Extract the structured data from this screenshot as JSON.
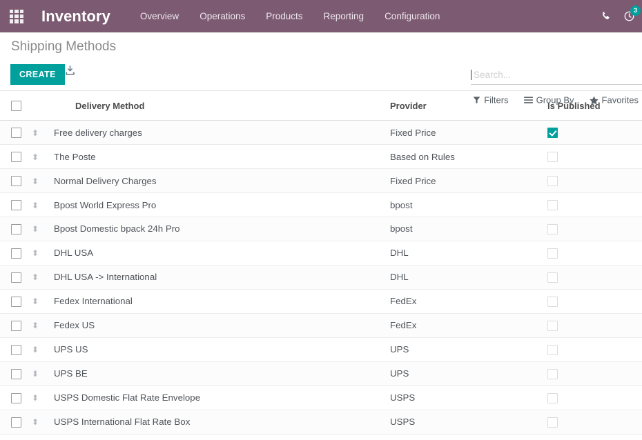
{
  "navbar": {
    "apps_icon": "apps-grid-icon",
    "brand": "Inventory",
    "menu": [
      {
        "label": "Overview"
      },
      {
        "label": "Operations"
      },
      {
        "label": "Products"
      },
      {
        "label": "Reporting"
      },
      {
        "label": "Configuration"
      }
    ],
    "phone_icon": "phone-icon",
    "activity_icon": "clock-activity-icon",
    "activity_count": "3",
    "bg_color": "#7c5a72",
    "badge_color": "#00a09d"
  },
  "control_panel": {
    "title": "Shipping Methods",
    "create_label": "CREATE",
    "export_icon": "download-export-icon",
    "search": {
      "placeholder": "Search...",
      "value": ""
    },
    "options": [
      {
        "label": "Filters",
        "icon": "filter-funnel-icon"
      },
      {
        "label": "Group By",
        "icon": "group-by-lines-icon"
      },
      {
        "label": "Favorites",
        "icon": "star-icon"
      }
    ]
  },
  "table": {
    "columns": [
      {
        "label": "Delivery Method"
      },
      {
        "label": "Provider"
      },
      {
        "label": "Is Published"
      }
    ],
    "select_all_checked": false,
    "rows": [
      {
        "name": "Free delivery charges",
        "provider": "Fixed Price",
        "published": true,
        "selected": false
      },
      {
        "name": "The Poste",
        "provider": "Based on Rules",
        "published": false,
        "selected": false
      },
      {
        "name": "Normal Delivery Charges",
        "provider": "Fixed Price",
        "published": false,
        "selected": false
      },
      {
        "name": "Bpost World Express Pro",
        "provider": "bpost",
        "published": false,
        "selected": false
      },
      {
        "name": "Bpost Domestic bpack 24h Pro",
        "provider": "bpost",
        "published": false,
        "selected": false
      },
      {
        "name": "DHL USA",
        "provider": "DHL",
        "published": false,
        "selected": false
      },
      {
        "name": "DHL USA -> International",
        "provider": "DHL",
        "published": false,
        "selected": false
      },
      {
        "name": "Fedex International",
        "provider": "FedEx",
        "published": false,
        "selected": false
      },
      {
        "name": "Fedex US",
        "provider": "FedEx",
        "published": false,
        "selected": false
      },
      {
        "name": "UPS US",
        "provider": "UPS",
        "published": false,
        "selected": false
      },
      {
        "name": "UPS BE",
        "provider": "UPS",
        "published": false,
        "selected": false
      },
      {
        "name": "USPS Domestic Flat Rate Envelope",
        "provider": "USPS",
        "published": false,
        "selected": false
      },
      {
        "name": "USPS International Flat Rate Box",
        "provider": "USPS",
        "published": false,
        "selected": false
      }
    ]
  }
}
